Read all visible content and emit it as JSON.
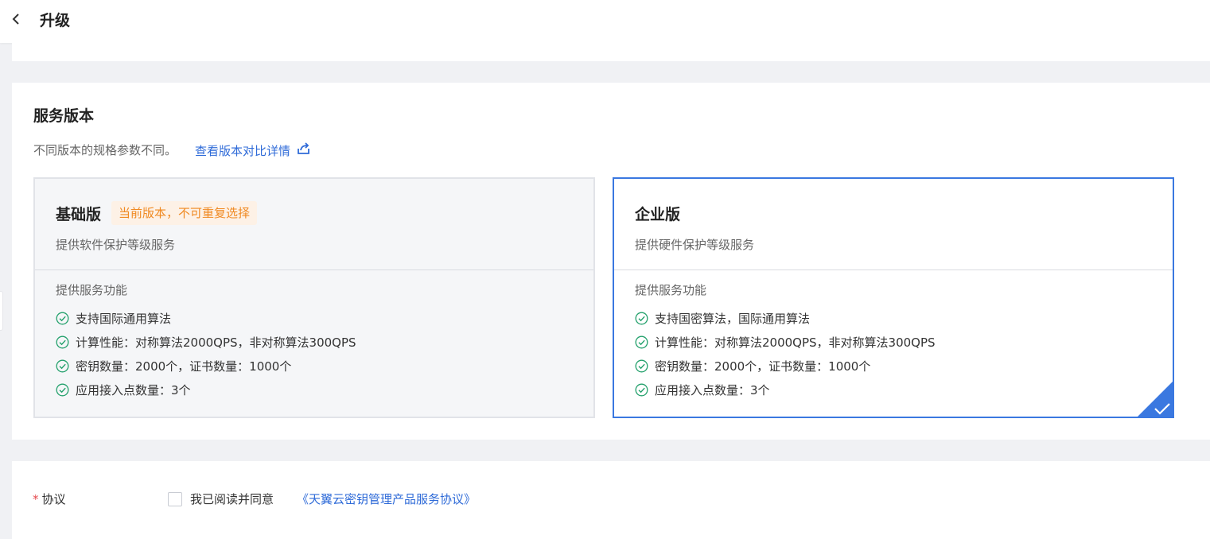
{
  "header": {
    "back_icon": "chevron-left-icon",
    "title": "升级"
  },
  "service": {
    "title": "服务版本",
    "description": "不同版本的规格参数不同。",
    "compare_link": "查看版本对比详情",
    "compare_icon": "external-share-icon"
  },
  "plans": [
    {
      "name": "基础版",
      "badge": "当前版本，不可重复选择",
      "description": "提供软件保护等级服务",
      "features_title": "提供服务功能",
      "features": [
        "支持国际通用算法",
        "计算性能：对称算法2000QPS，非对称算法300QPS",
        "密钥数量：2000个，证书数量：1000个",
        "应用接入点数量：3个"
      ],
      "state": "current-disabled"
    },
    {
      "name": "企业版",
      "description": "提供硬件保护等级服务",
      "features_title": "提供服务功能",
      "features": [
        "支持国密算法，国际通用算法",
        "计算性能：对称算法2000QPS，非对称算法300QPS",
        "密钥数量：2000个，证书数量：1000个",
        "应用接入点数量：3个"
      ],
      "state": "selected"
    }
  ],
  "agreement": {
    "required_mark": "*",
    "label": "协议",
    "checked": false,
    "text": "我已阅读并同意",
    "link": "《天翼云密钥管理产品服务协议》"
  },
  "colors": {
    "accent": "#3a78e0",
    "link": "#2f6bd8",
    "badge_text": "#f08a23",
    "badge_bg": "#fdf1e6",
    "check": "#22a06b",
    "required": "#e5484d"
  }
}
